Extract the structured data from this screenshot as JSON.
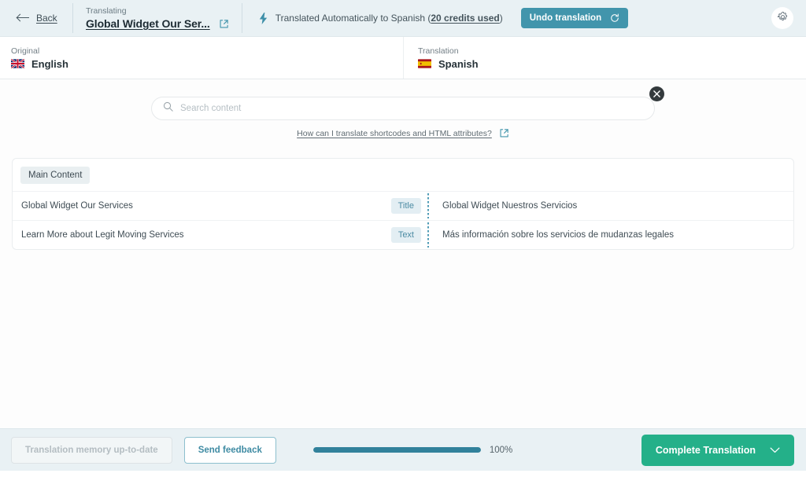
{
  "header": {
    "back_label": "Back",
    "translating_label": "Translating",
    "document_title": "Global Widget Our Ser...",
    "open_external_icon": "external-link-icon",
    "status_icon": "lightning-bolt-icon",
    "status_text_before": "Translated Automatically to Spanish (",
    "status_credits": "20 credits used",
    "status_text_after": ")",
    "undo_label": "Undo translation",
    "undo_icon": "undo-rotate-icon",
    "settings_icon": "gear-icon",
    "accent_teal": "#4295ac",
    "background": "#e9f1f4"
  },
  "languages": {
    "original_caption": "Original",
    "original_language": "English",
    "original_flag": "flag-uk-icon",
    "translation_caption": "Translation",
    "translation_language": "Spanish",
    "translation_flag": "flag-spain-icon"
  },
  "search": {
    "placeholder": "Search content",
    "value": "",
    "icon": "search-icon",
    "close_icon": "close-icon",
    "help_link": "How can I translate shortcodes and HTML attributes?",
    "help_link_icon": "external-link-icon"
  },
  "content": {
    "tabs": [
      {
        "label": "Main Content",
        "active": true
      }
    ],
    "rows": [
      {
        "source": "Global Widget Our Services",
        "badge": "Title",
        "target": "Global Widget Nuestros Servicios"
      },
      {
        "source": "Learn More about Legit Moving Services",
        "badge": "Text",
        "target": "Más información sobre los servicios de mudanzas legales"
      }
    ]
  },
  "footer": {
    "translation_memory_label": "Translation memory up-to-date",
    "send_feedback_label": "Send feedback",
    "progress_percent": 100,
    "progress_label": "100%",
    "complete_label": "Complete Translation",
    "complete_icon": "chevron-down-icon",
    "complete_color": "#24b089"
  }
}
